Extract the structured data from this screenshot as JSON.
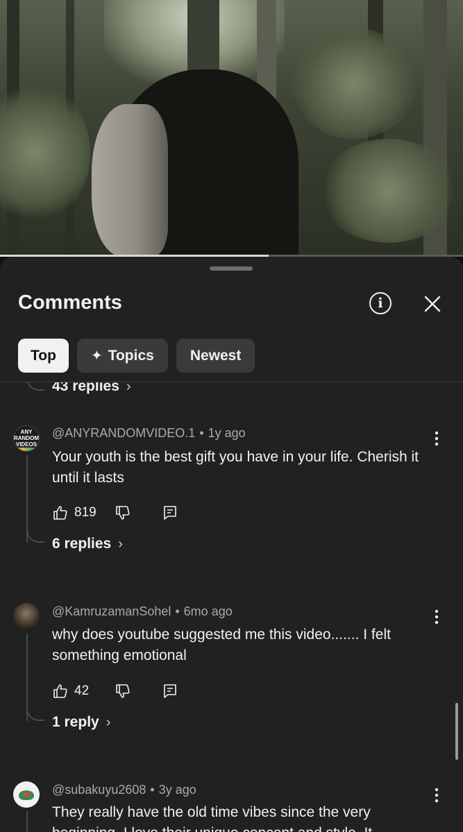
{
  "video": {
    "progress": 0.58
  },
  "sheet": {
    "title": "Comments",
    "icons": {
      "info": "info-circle-icon",
      "close": "close-icon"
    },
    "chips": [
      {
        "label": "Top",
        "active": true
      },
      {
        "label": "Topics",
        "icon": "sparkle-icon",
        "icon_glyph": "✦"
      },
      {
        "label": "Newest"
      }
    ]
  },
  "previous_thread": {
    "replies_label": "43 replies"
  },
  "comments": [
    {
      "author": "@ANYRANDOMVIDEO.1",
      "age": "1y ago",
      "text": "Your youth is the best gift you have in your life. Cherish it until it lasts",
      "likes": "819",
      "replies_label": "6 replies",
      "avatar_text": [
        "ANY",
        "RANDOM",
        "VIDEOS"
      ]
    },
    {
      "author": "@KamruzamanSohel",
      "age": "6mo ago",
      "text": "why does youtube suggested me this video....... I felt something emotional",
      "likes": "42",
      "replies_label": "1 reply"
    },
    {
      "author": "@subakuyu2608",
      "age": "3y ago",
      "text": "They really have the old time vibes since the very beginning. I love their unique concept and style. It"
    }
  ],
  "dot": "•",
  "chevron": "›"
}
